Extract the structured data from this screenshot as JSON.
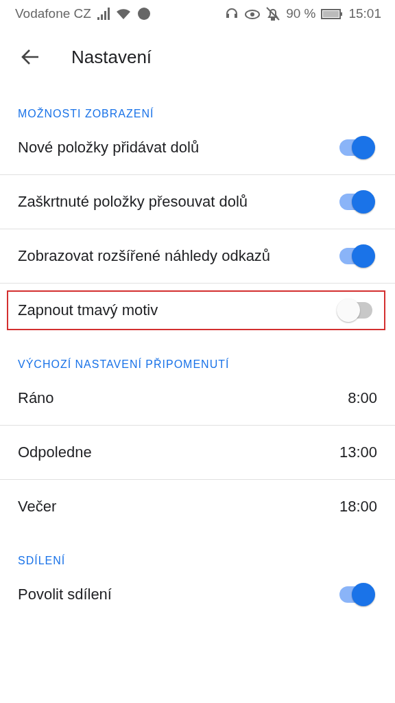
{
  "status_bar": {
    "carrier": "Vodafone CZ",
    "battery": "90 %",
    "time": "15:01"
  },
  "header": {
    "title": "Nastavení"
  },
  "sections": [
    {
      "title": "MOŽNOSTI ZOBRAZENÍ",
      "items": [
        {
          "kind": "switch",
          "label": "Nové položky přidávat dolů",
          "on": true,
          "highlighted": false
        },
        {
          "kind": "switch",
          "label": "Zaškrtnuté položky přesouvat dolů",
          "on": true,
          "highlighted": false
        },
        {
          "kind": "switch",
          "label": "Zobrazovat rozšířené náhledy odkazů",
          "on": true,
          "highlighted": false
        },
        {
          "kind": "switch",
          "label": "Zapnout tmavý motiv",
          "on": false,
          "highlighted": true
        }
      ]
    },
    {
      "title": "VÝCHOZÍ NASTAVENÍ PŘIPOMENUTÍ",
      "items": [
        {
          "kind": "time",
          "label": "Ráno",
          "value": "8:00"
        },
        {
          "kind": "time",
          "label": "Odpoledne",
          "value": "13:00"
        },
        {
          "kind": "time",
          "label": "Večer",
          "value": "18:00"
        }
      ]
    },
    {
      "title": "SDÍLENÍ",
      "items": [
        {
          "kind": "switch",
          "label": "Povolit sdílení",
          "on": true,
          "highlighted": false
        }
      ]
    }
  ]
}
